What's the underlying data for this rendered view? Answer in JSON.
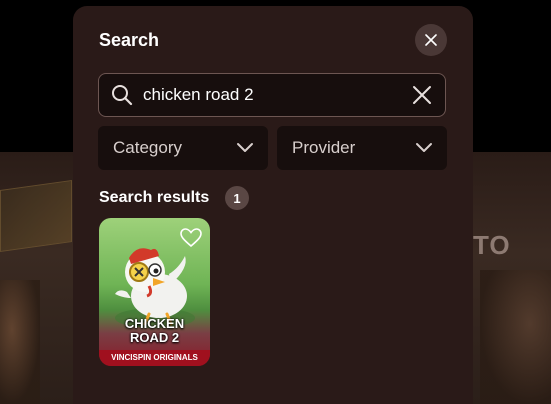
{
  "background": {
    "partial_text": "TO"
  },
  "modal": {
    "title": "Search",
    "close_icon": "close-icon"
  },
  "search": {
    "value": "chicken road 2",
    "placeholder": "",
    "icon": "search-icon",
    "clear_icon": "clear-icon"
  },
  "filters": {
    "category_label": "Category",
    "provider_label": "Provider"
  },
  "results": {
    "label": "Search results",
    "count": "1",
    "items": [
      {
        "title_line1": "CHICKEN",
        "title_line2": "ROAD 2",
        "provider": "VINCISPIN ORIGINALS",
        "favorite_icon": "heart-icon"
      }
    ]
  },
  "colors": {
    "modal_bg": "#2a1a18",
    "input_bg": "#170e0d",
    "badge_bg": "#5a4744",
    "card_banner": "#a0101e"
  }
}
